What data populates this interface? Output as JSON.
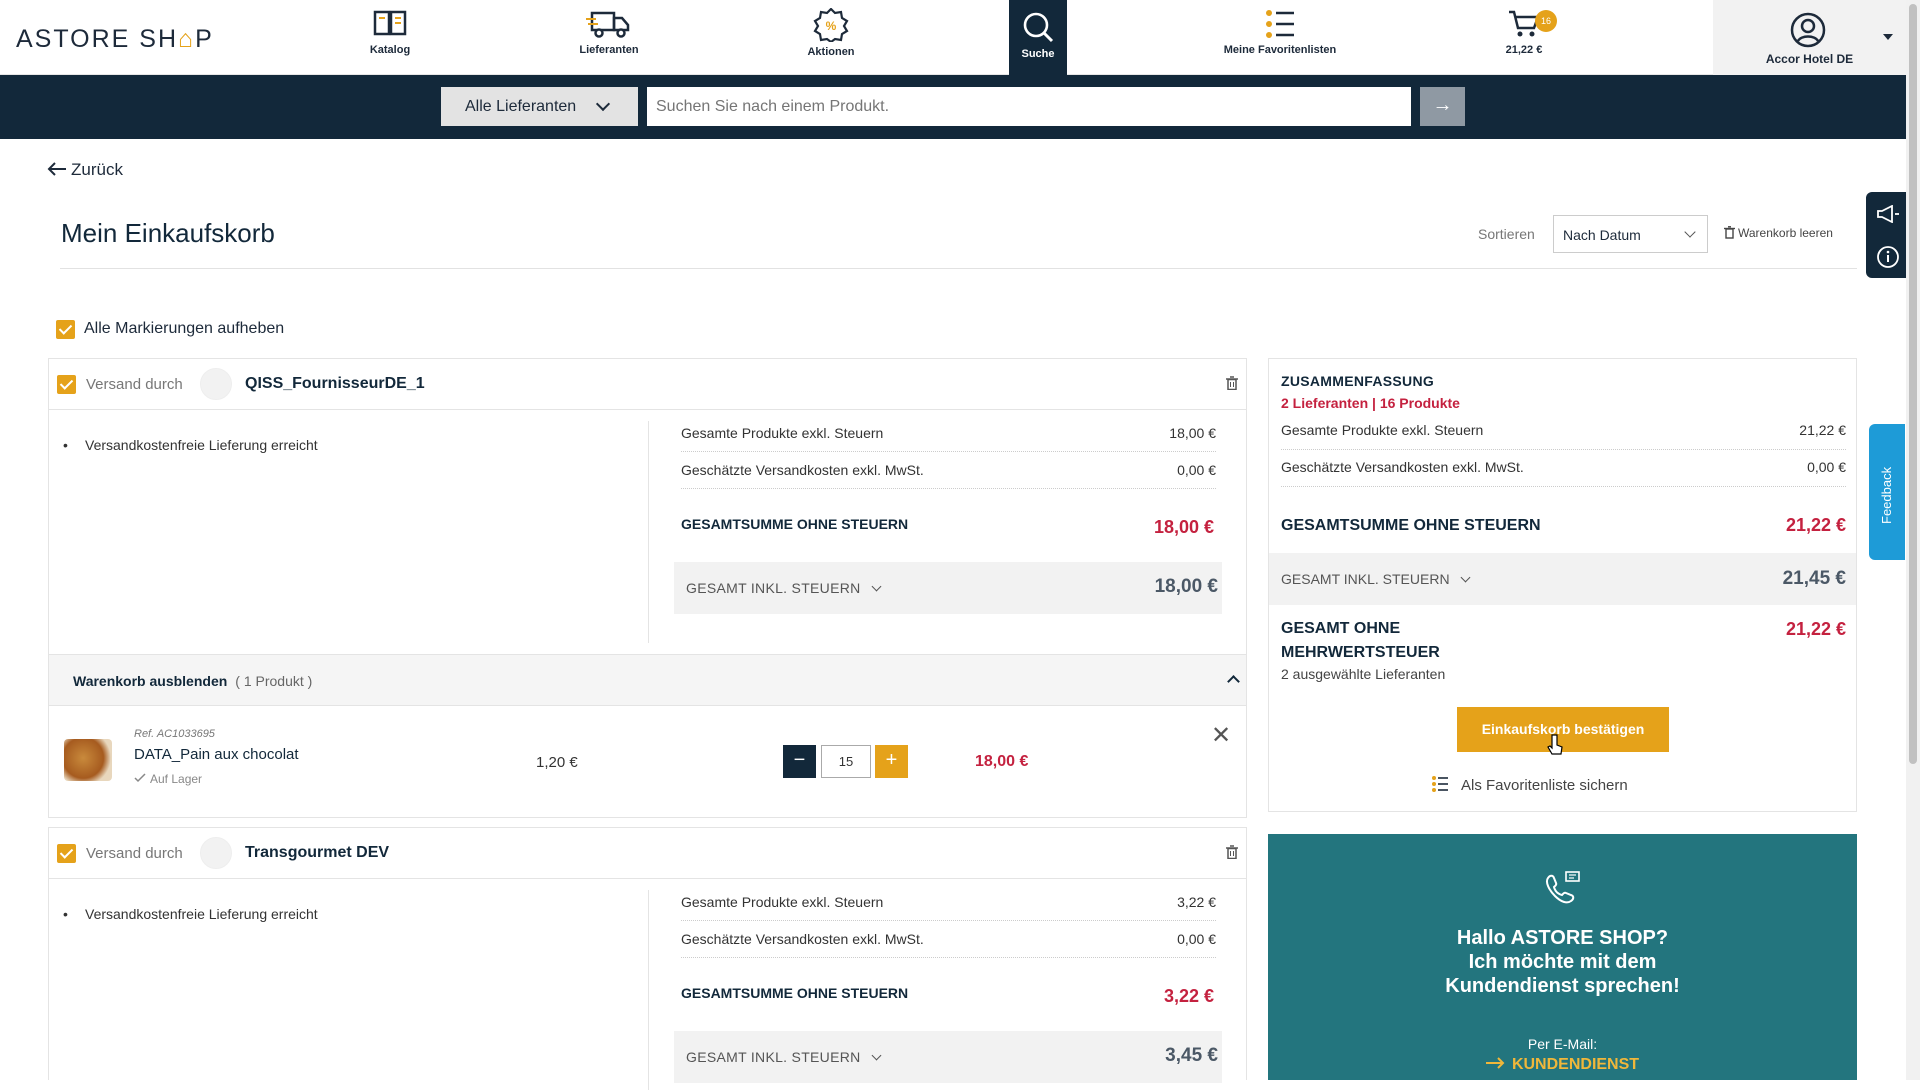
{
  "header": {
    "logo_text_a": "ASTORE SH",
    "logo_text_b": "⌂",
    "logo_text_c": "P",
    "nav": [
      {
        "label": "Katalog",
        "icon": "book-icon"
      },
      {
        "label": "Lieferanten",
        "icon": "truck-icon"
      },
      {
        "label": "Aktionen",
        "icon": "percent-badge-icon"
      },
      {
        "label": "Suche",
        "icon": "search-icon"
      },
      {
        "label": "Meine Favoritenlisten",
        "icon": "list-icon"
      },
      {
        "label": "21,22 €",
        "icon": "cart-icon"
      }
    ],
    "cart_count": "16",
    "account_label": "Accor Hotel DE"
  },
  "search": {
    "supplier_select": "Alle Lieferanten",
    "placeholder": "Suchen Sie nach einem Produkt.",
    "go_label": "→"
  },
  "page": {
    "back_label": "Zurück",
    "title": "Mein Einkaufskorb",
    "sort_label": "Sortieren",
    "sort_value": "Nach Datum",
    "empty_cart": "Warenkorb leeren",
    "select_all": "Alle Markierungen aufheben"
  },
  "suppliers": [
    {
      "ship_by": "Versand durch",
      "name": "QISS_FournisseurDE_1",
      "note": "Versandkostenfreie Lieferung erreicht",
      "products_label": "Gesamte Produkte exkl. Steuern",
      "products_value": "18,00 €",
      "shipping_label": "Geschätzte Versandkosten exkl. MwSt.",
      "shipping_value": "0,00 €",
      "total_label": "GESAMTSUMME OHNE STEUERN",
      "total_value": "18,00 €",
      "incl_label": "GESAMT INKL. STEUERN",
      "incl_value": "18,00 €",
      "hide_label": "Warenkorb ausblenden",
      "hide_count": "( 1 Produkt )",
      "product": {
        "ref": "Ref. AC1033695",
        "name": "DATA_Pain aux chocolat",
        "stock": "Auf Lager",
        "unit_price": "1,20 €",
        "quantity": "15",
        "line_total": "18,00 €"
      }
    },
    {
      "ship_by": "Versand durch",
      "name": "Transgourmet DEV",
      "note": "Versandkostenfreie Lieferung erreicht",
      "products_label": "Gesamte Produkte exkl. Steuern",
      "products_value": "3,22 €",
      "shipping_label": "Geschätzte Versandkosten exkl. MwSt.",
      "shipping_value": "0,00 €",
      "total_label": "GESAMTSUMME OHNE STEUERN",
      "total_value": "3,22 €",
      "incl_label": "GESAMT INKL. STEUERN",
      "incl_value": "3,45 €"
    }
  ],
  "summary": {
    "title": "ZUSAMMENFASSUNG",
    "subtitle": "2 Lieferanten | 16 Produkte",
    "products_label": "Gesamte Produkte exkl. Steuern",
    "products_value": "21,22 €",
    "shipping_label": "Geschätzte Versandkosten exkl. MwSt.",
    "shipping_value": "0,00 €",
    "total_label": "GESAMTSUMME OHNE STEUERN",
    "total_value": "21,22 €",
    "incl_label": "GESAMT INKL. STEUERN",
    "incl_value": "21,45 €",
    "net_label": "GESAMT OHNE MEHRWERTSTEUER",
    "net_value": "21,22 €",
    "net_sub": "2 ausgewählte Lieferanten",
    "confirm_label": "Einkaufskorb bestätigen",
    "save_fav_label": "Als Favoritenliste sichern"
  },
  "help": {
    "title": "Hallo ASTORE SHOP? Ich möchte mit dem Kundendienst sprechen!",
    "sub": "Per E-Mail:",
    "link": "KUNDENDIENST"
  },
  "feedback_label": "Feedback",
  "colors": {
    "navy": "#12283a",
    "accent": "#e5a21a",
    "price_red": "#c4213f",
    "help_teal": "#23757e",
    "feedback_blue": "#1e9bd7"
  }
}
